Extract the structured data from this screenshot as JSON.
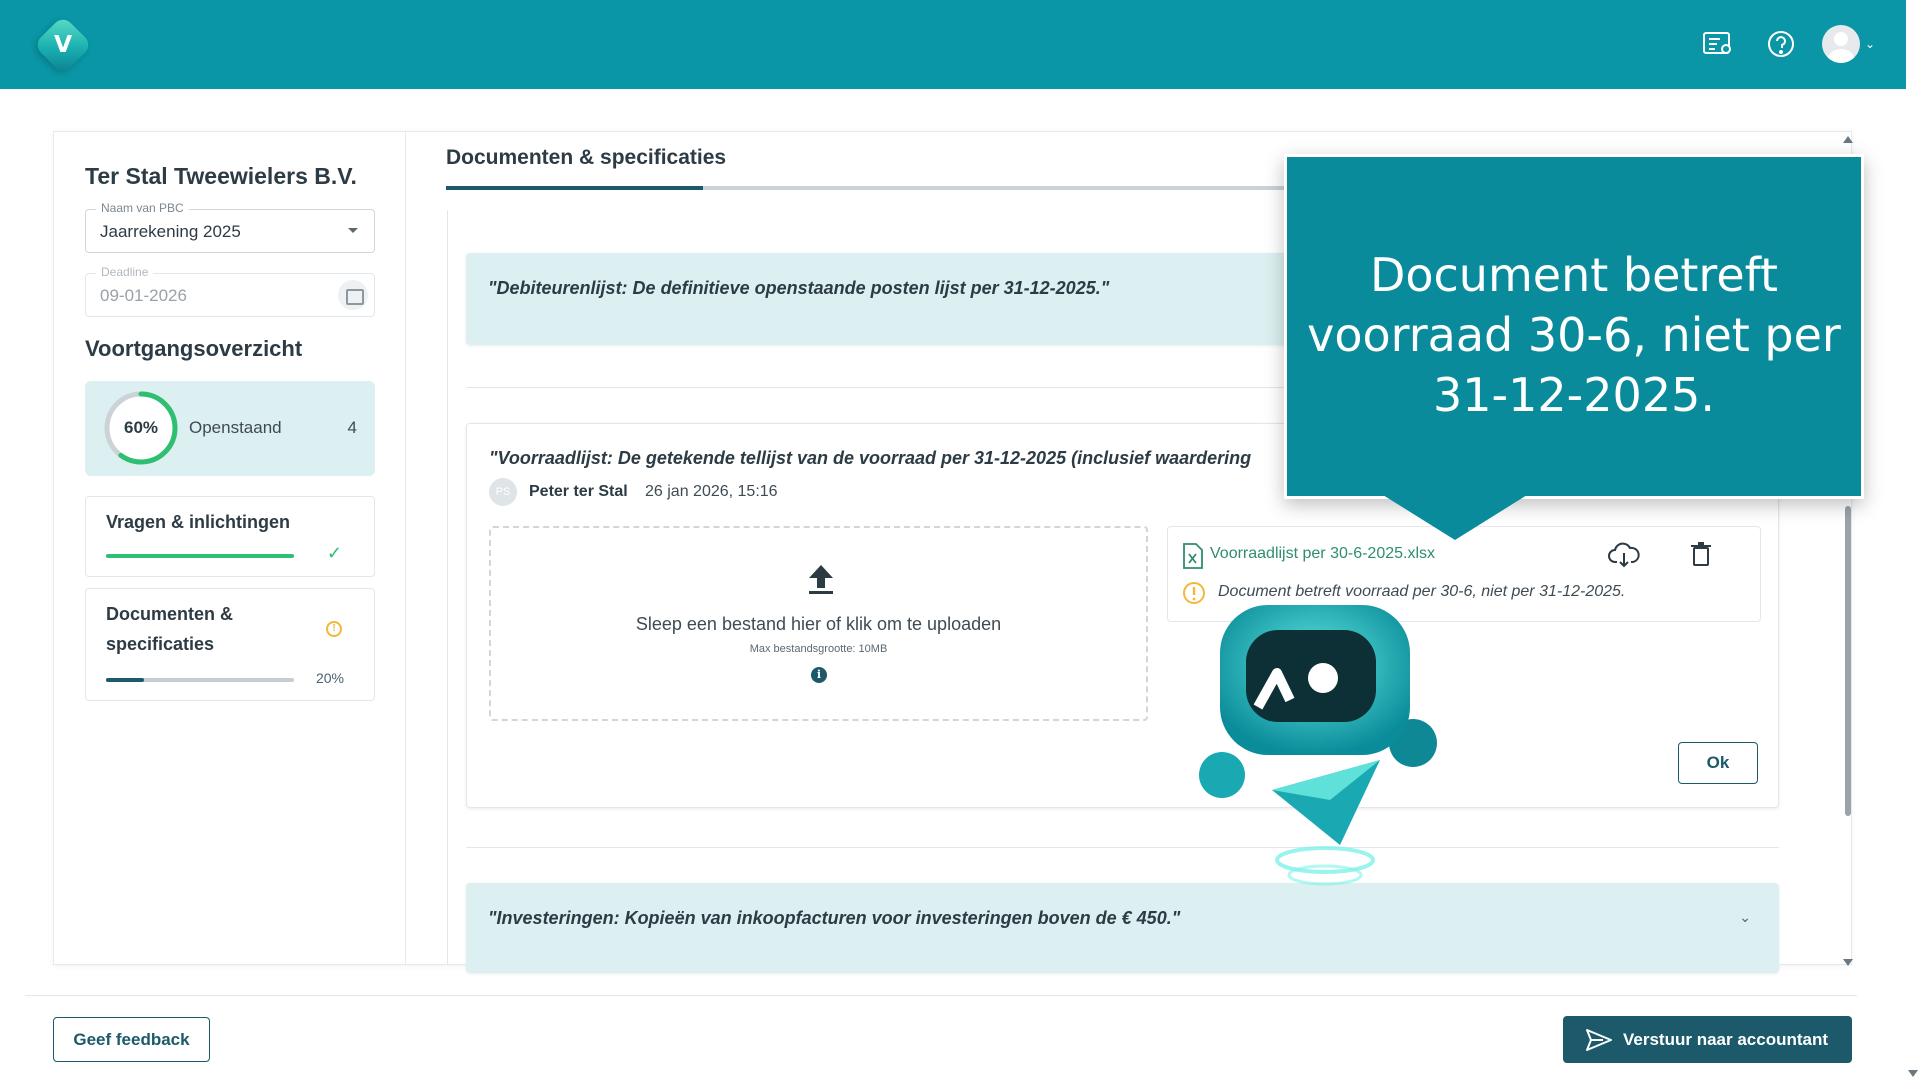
{
  "header": {
    "logo_letter": "V",
    "icons": [
      "feedback-list-icon",
      "help-icon",
      "user-avatar-icon"
    ],
    "brand_color": "#0a96a6"
  },
  "sidebar": {
    "company_name": "Ter Stal Tweewielers B.V.",
    "pbc_field": {
      "label": "Naam van PBC",
      "value": "Jaarrekening 2025"
    },
    "deadline_field": {
      "label": "Deadline",
      "value": "09-01-2026"
    },
    "overview_title": "Voortgangsoverzicht",
    "progress": {
      "percent_label": "60%",
      "percent": 60,
      "status_label": "Openstaand",
      "count": "4"
    },
    "steps": [
      {
        "title": "Vragen & inlichtingen",
        "progress": 100,
        "state": "complete"
      },
      {
        "title": "Documenten & specificaties",
        "progress": 20,
        "percent_label": "20%",
        "state": "warning"
      }
    ]
  },
  "content": {
    "title": "Documenten & specificaties",
    "tab_progress": 20,
    "requests": [
      {
        "text": "\"Debiteurenlijst: De definitieve openstaande posten lijst per 31-12-2025.\""
      },
      {
        "text": "\"Voorraadlijst: De getekende tellijst van de voorraad per 31-12-2025 (inclusief waardering",
        "user_initials": "PS",
        "user_name": "Peter ter Stal",
        "date": "26 jan 2026, 15:16",
        "upload": {
          "text": "Sleep een bestand hier of klik om te uploaden",
          "max_size": "Max bestandsgrootte: 10MB"
        },
        "file": {
          "name": "Voorraadlijst per 30-6-2025.xlsx",
          "warning": "Document betreft voorraad per 30-6, niet per 31-12-2025."
        },
        "ok_label": "Ok"
      },
      {
        "text": "\"Investeringen: Kopieën van inkoopfacturen voor investeringen boven de € 450.\""
      }
    ]
  },
  "callout": {
    "text": "Document betreft voorraad 30-6, niet per 31-12-2025."
  },
  "footer": {
    "feedback_label": "Geef feedback",
    "send_label": "Verstuur naar accountant"
  }
}
